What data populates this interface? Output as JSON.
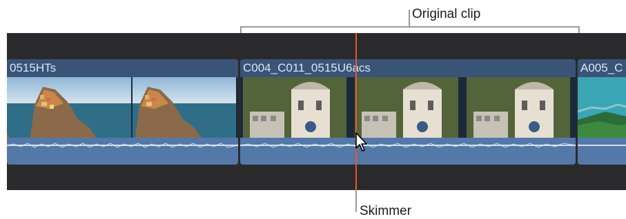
{
  "callouts": {
    "original_clip": "Original clip",
    "skimmer": "Skimmer"
  },
  "clips": [
    {
      "title": "0515HTs"
    },
    {
      "title": "C004_C011_0515U6acs"
    },
    {
      "title": "A005_C"
    }
  ],
  "colors": {
    "timeline_bg": "#2a2a2d",
    "clip_title_bg": "#3a5478",
    "audio_bg": "#5478a8",
    "skimmer": "#e8582b"
  }
}
